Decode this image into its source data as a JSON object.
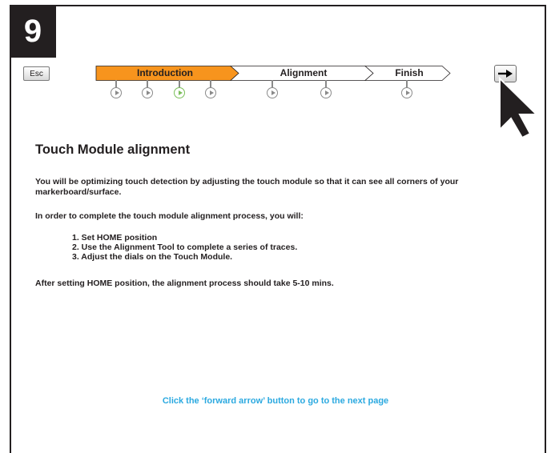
{
  "step_number": "9",
  "esc_label": "Esc",
  "progress": {
    "segments": [
      {
        "label": "Introduction",
        "state": "current"
      },
      {
        "label": "Alignment",
        "state": "upcoming"
      },
      {
        "label": "Finish",
        "state": "upcoming"
      }
    ],
    "active_color": "#f7941d",
    "active_dot_color": "#7bbf5a"
  },
  "forward_icon": "right-arrow-icon",
  "cursor_icon": "mouse-pointer-icon",
  "content": {
    "title": "Touch Module alignment",
    "paragraph1": "You will be optimizing touch detection by adjusting the touch module so that it can see all corners of your markerboard/surface.",
    "paragraph2": "In order to complete the touch module alignment process, you will:",
    "steps": [
      "1. Set HOME position",
      "2. Use the Alignment Tool to complete a series of traces.",
      "3. Adjust the dials on the Touch Module."
    ],
    "paragraph3": "After setting HOME position, the alignment process should take 5-10 mins."
  },
  "footer_hint": "Click the ‘forward arrow’ button to go to the next page"
}
